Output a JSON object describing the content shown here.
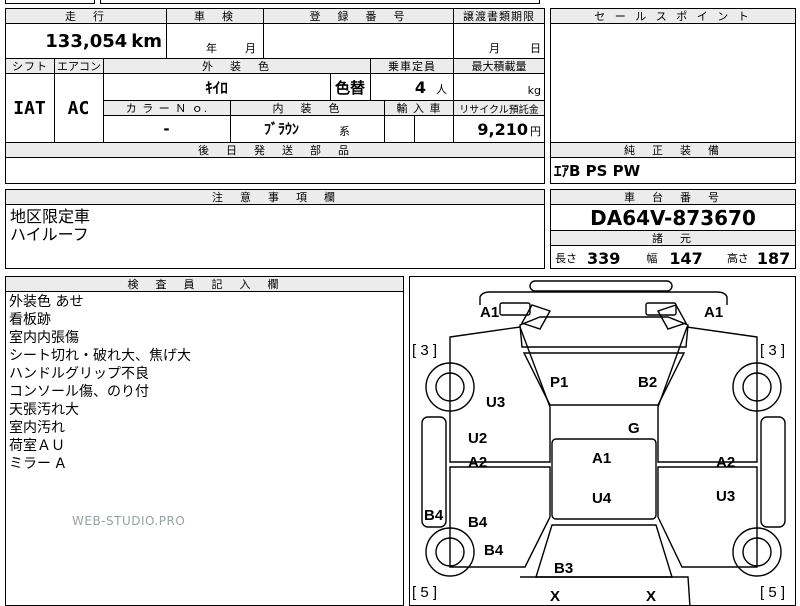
{
  "top_left_fragment": "",
  "top_mid_fragment": "",
  "mileage": {
    "header": "走　行",
    "value": "133,054",
    "unit": "km"
  },
  "inspection": {
    "header": "車　検",
    "year_label": "年",
    "month_label": "月"
  },
  "registration": {
    "header": "登　録　番　号"
  },
  "transfer_deadline": {
    "header": "譲渡書類期限",
    "month_label": "月",
    "day_label": "日"
  },
  "shift": {
    "header": "シフト",
    "value": "IAT"
  },
  "aircon": {
    "header": "エアコン",
    "value": "AC"
  },
  "exterior_color": {
    "header": "外　装　色",
    "value": "ｷｲﾛ",
    "repaint_label": "色替"
  },
  "capacity": {
    "header": "乗車定員",
    "value": "4",
    "unit": "人"
  },
  "max_load": {
    "header": "最大積載量",
    "unit": "kg"
  },
  "color_no": {
    "header": "カ ラ ー Ｎ ｏ.",
    "value": "-"
  },
  "interior_color": {
    "header": "内　装　色",
    "value": "ﾌﾞﾗｳﾝ",
    "suffix": "系"
  },
  "import": {
    "header": "輸 入 車"
  },
  "recycle": {
    "header": "リサイクル預託金",
    "value": "9,210",
    "unit": "円"
  },
  "later_parts": {
    "header": "後　日　発　送　部　品"
  },
  "sales_point": {
    "header": "セ ー ル ス ポ イ ン ト"
  },
  "genuine_equipment": {
    "header": "純　正　装　備",
    "value": "ｴｱB PS PW"
  },
  "notes": {
    "header": "注　意　事　項　欄",
    "lines": [
      "地区限定車",
      "ハイルーフ"
    ]
  },
  "chassis": {
    "header": "車　台　番　号",
    "value": "DA64V-873670"
  },
  "specs": {
    "header": "諸　元",
    "length_label": "長さ",
    "length": "339",
    "width_label": "幅",
    "width": "147",
    "height_label": "高さ",
    "height": "187"
  },
  "inspector": {
    "header": "検　査　員　記　入　欄",
    "lines": [
      "外装色 あせ",
      "看板跡",
      "室内内張傷",
      "シート切れ・破れ大、焦げ大",
      "ハンドルグリップ不良",
      "コンソール傷、のり付",
      "天張汚れ大",
      "室内汚れ",
      "荷室ＡＵ",
      "ミラー A"
    ]
  },
  "diagram": {
    "marks": {
      "front_left": "A1",
      "front_right": "A1",
      "tyre_front_left": "[ 3 ]",
      "tyre_front_right": "[ 3 ]",
      "seat_p1": "P1",
      "seat_b2": "B2",
      "left_u3": "U3",
      "glass_g": "G",
      "left_u2": "U2",
      "left_a2": "A2",
      "right_a2": "A2",
      "roof_a1": "A1",
      "roof_u4": "U4",
      "right_u3": "U3",
      "left_b4_outer": "B4",
      "left_b4_inner": "B4",
      "left_b4_low": "B4",
      "rear_b3": "B3",
      "tyre_rear_left": "[ 5 ]",
      "tyre_rear_right": "[ 5 ]",
      "rear_x1": "X",
      "rear_x2": "X"
    }
  },
  "watermark": "WEB-STUDIO.PRO"
}
